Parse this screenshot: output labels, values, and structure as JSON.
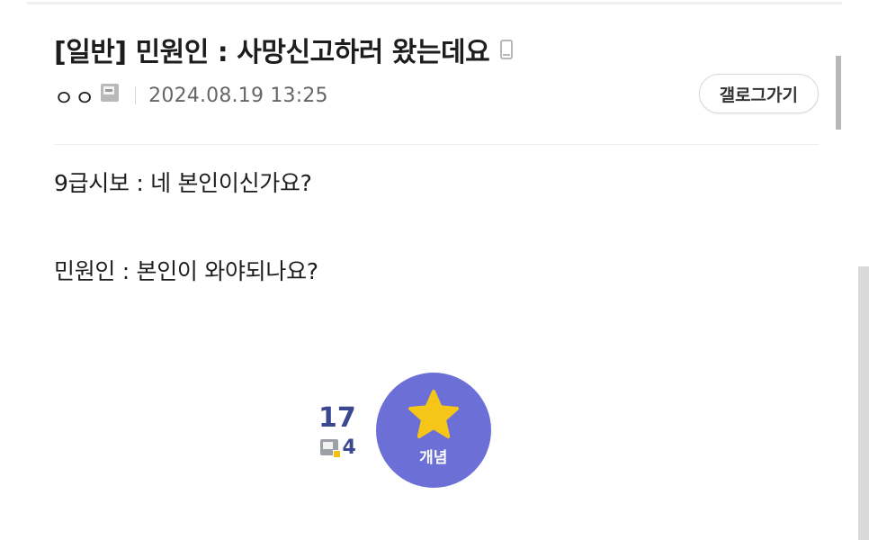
{
  "post": {
    "title": "[일반] 민원인 : 사망신고하러 왔는데요",
    "title_suffix_icon": "mobile-icon",
    "author": {
      "nickname": "ㅇㅇ",
      "badge_icon": "user-icon"
    },
    "date": "2024.08.19 13:25",
    "gallery_button_label": "갤로그가기"
  },
  "content": {
    "lines": [
      "9급시보 : 네 본인이신가요?",
      "민원인 : 본인이 와야되나요?"
    ]
  },
  "recommend": {
    "count": "17",
    "fixed_count": "4",
    "fixed_icon": "fixed-user-icon",
    "button_label": "개념",
    "button_icon": "star-icon",
    "button_color": "#6c6fd6",
    "star_color": "#f5c518"
  }
}
